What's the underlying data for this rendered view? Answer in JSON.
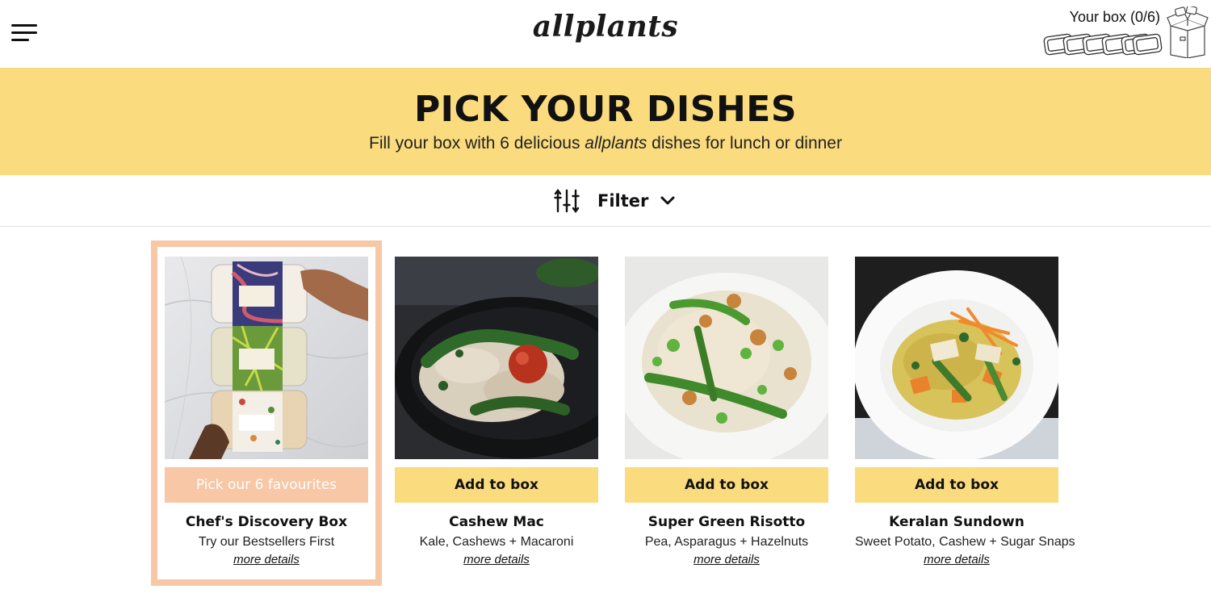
{
  "header": {
    "logo_text": "allplants",
    "menu_icon": "hamburger-menu-icon",
    "cart_label": "Your box (0/6)",
    "cart_icon": "box-icon",
    "tray_icon": "meal-tray-icon"
  },
  "banner": {
    "title": "PICK YOUR DISHES",
    "subtitle_before": "Fill your box with 6 delicious ",
    "subtitle_brand": "allplants",
    "subtitle_after": " dishes for lunch or dinner",
    "background_color": "#fadb7e"
  },
  "filter": {
    "label": "Filter",
    "icon": "sliders-icon",
    "chevron_icon": "chevron-down-icon"
  },
  "colors": {
    "accent_yellow": "#fadb7e",
    "accent_peach": "#f7c7a6"
  },
  "dishes": [
    {
      "name": "Chef's Discovery Box",
      "description": "Try our Bestsellers First",
      "cta_label": "Pick our 6 favourites",
      "more_label": "more details",
      "featured": true
    },
    {
      "name": "Cashew Mac",
      "description": "Kale, Cashews + Macaroni",
      "cta_label": "Add to box",
      "more_label": "more details",
      "featured": false
    },
    {
      "name": "Super Green Risotto",
      "description": "Pea, Asparagus + Hazelnuts",
      "cta_label": "Add to box",
      "more_label": "more details",
      "featured": false
    },
    {
      "name": "Keralan Sundown",
      "description": "Sweet Potato, Cashew + Sugar Snaps",
      "cta_label": "Add to box",
      "more_label": "more details",
      "featured": false
    }
  ]
}
